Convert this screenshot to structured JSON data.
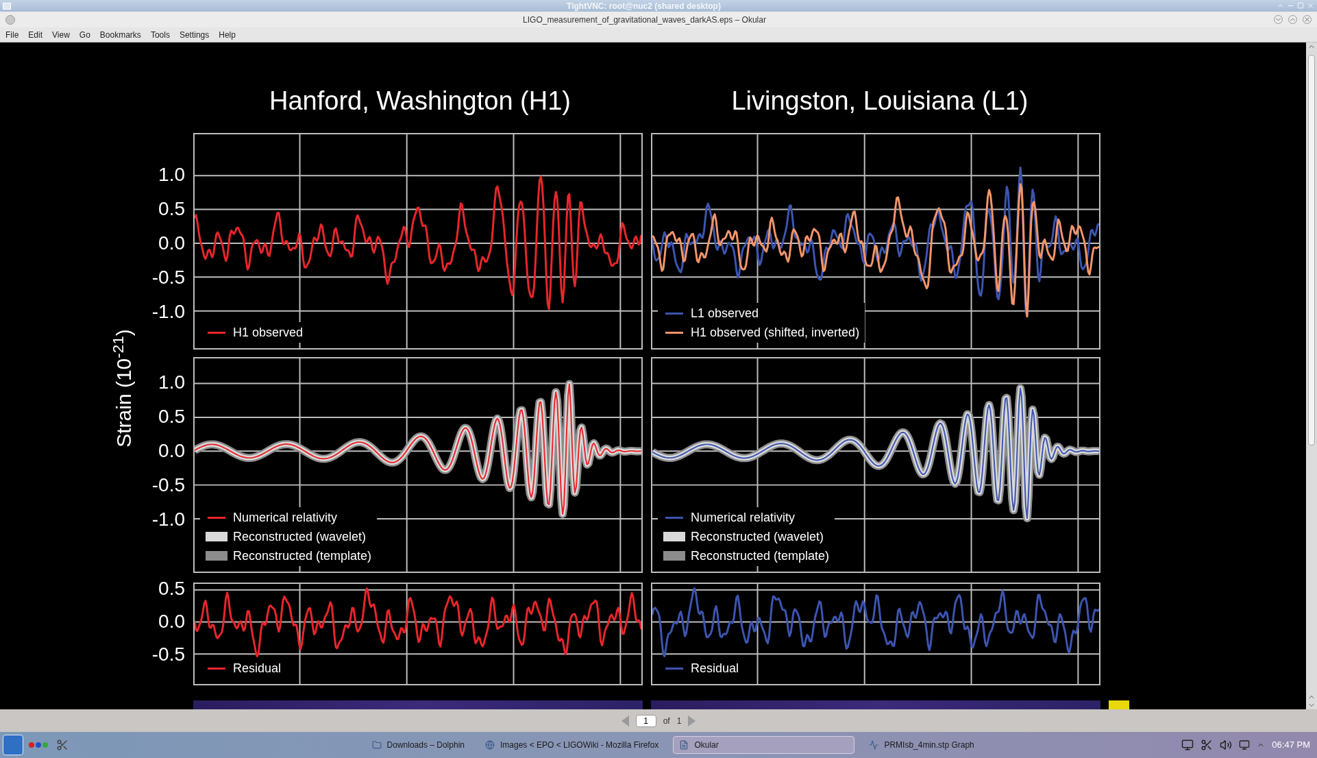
{
  "vnc_title": "TightVNC: root@nuc2 (shared desktop)",
  "window": {
    "title": "LIGO_measurement_of_gravitational_waves_darkAS.eps – Okular"
  },
  "menu": [
    "File",
    "Edit",
    "View",
    "Go",
    "Bookmarks",
    "Tools",
    "Settings",
    "Help"
  ],
  "document": {
    "ylabel": "Strain (10$^{-21}$)",
    "columns": [
      {
        "title": "Hanford, Washington (H1)"
      },
      {
        "title": "Livingston, Louisiana (L1)"
      }
    ],
    "rows": [
      {
        "kind": "observed",
        "yticks": [
          "1.0",
          "0.5",
          "0.0",
          "-0.5",
          "-1.0"
        ],
        "panels": [
          {
            "legend": [
              {
                "label": "H1 observed",
                "kind": "line",
                "color": "#e8262b"
              }
            ]
          },
          {
            "legend": [
              {
                "label": "L1 observed",
                "kind": "line",
                "color": "#3d55b0"
              },
              {
                "label": "H1 observed (shifted, inverted)",
                "kind": "line",
                "color": "#f4956a"
              }
            ]
          }
        ]
      },
      {
        "kind": "reconstructed",
        "yticks": [
          "1.0",
          "0.5",
          "0.0",
          "-0.5",
          "-1.0"
        ],
        "panels": [
          {
            "legend": [
              {
                "label": "Numerical relativity",
                "kind": "line",
                "color": "#e8262b"
              },
              {
                "label": "Reconstructed (wavelet)",
                "kind": "band",
                "color": "#d9d9d9"
              },
              {
                "label": "Reconstructed (template)",
                "kind": "band",
                "color": "#8c8c8c"
              }
            ]
          },
          {
            "legend": [
              {
                "label": "Numerical relativity",
                "kind": "line",
                "color": "#3d55b0"
              },
              {
                "label": "Reconstructed (wavelet)",
                "kind": "band",
                "color": "#d9d9d9"
              },
              {
                "label": "Reconstructed (template)",
                "kind": "band",
                "color": "#8c8c8c"
              }
            ]
          }
        ]
      },
      {
        "kind": "residual",
        "yticks": [
          "0.5",
          "0.0",
          "-0.5"
        ],
        "panels": [
          {
            "legend": [
              {
                "label": "Residual",
                "kind": "line",
                "color": "#e8262b"
              }
            ]
          },
          {
            "legend": [
              {
                "label": "Residual",
                "kind": "line",
                "color": "#3d55b0"
              }
            ]
          }
        ]
      }
    ]
  },
  "page_bar": {
    "page": "1",
    "of": "of",
    "total": "1"
  },
  "taskbar": {
    "tasks": [
      {
        "label": "Downloads – Dolphin",
        "selected": false
      },
      {
        "label": "Images < EPO < LIGOWiki - Mozilla Firefox",
        "selected": false
      },
      {
        "label": "Okular",
        "selected": true
      },
      {
        "label": "PRMIsb_4min.stp Graph",
        "selected": false
      }
    ],
    "clock": "06:47 PM"
  }
}
